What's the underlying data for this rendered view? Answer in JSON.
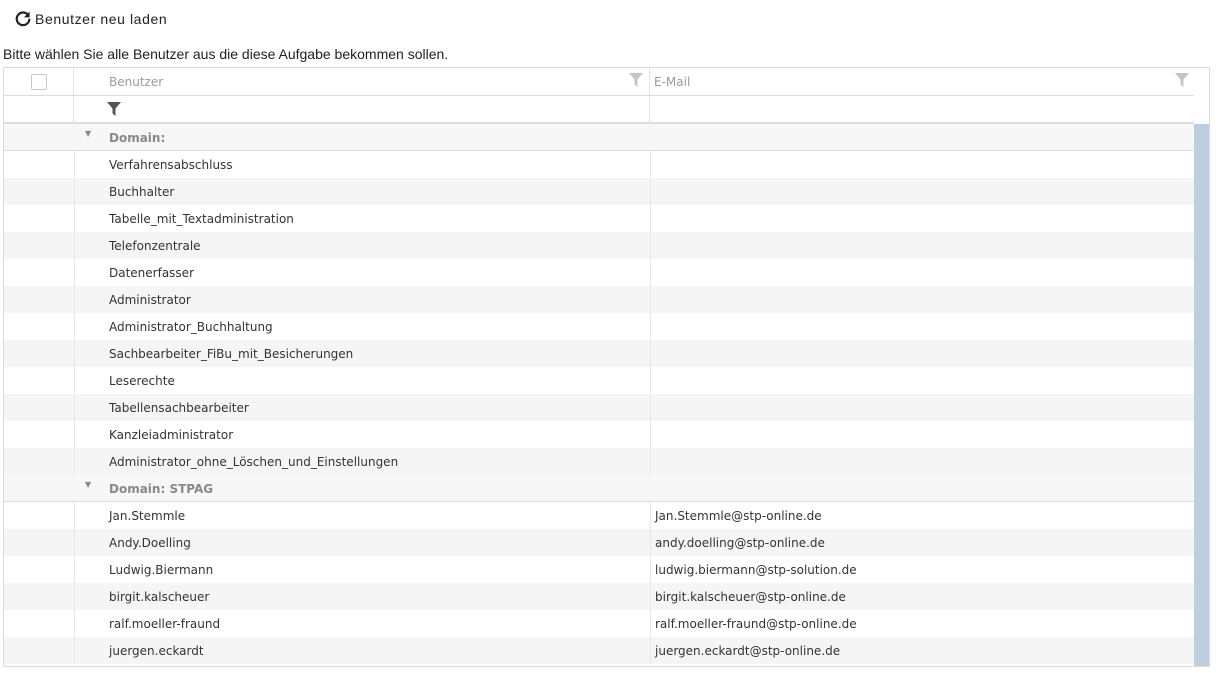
{
  "toolbar": {
    "reload_label": "Benutzer neu laden"
  },
  "instruction": "Bitte wählen Sie alle Benutzer aus die diese Aufgabe bekommen sollen.",
  "columns": {
    "user": "Benutzer",
    "email": "E-Mail"
  },
  "groups": [
    {
      "label": "Domain:",
      "rows": [
        {
          "user": "Verfahrensabschluss",
          "email": ""
        },
        {
          "user": "Buchhalter",
          "email": ""
        },
        {
          "user": "Tabelle_mit_Textadministration",
          "email": ""
        },
        {
          "user": "Telefonzentrale",
          "email": ""
        },
        {
          "user": "Datenerfasser",
          "email": ""
        },
        {
          "user": "Administrator",
          "email": ""
        },
        {
          "user": "Administrator_Buchhaltung",
          "email": ""
        },
        {
          "user": "Sachbearbeiter_FiBu_mit_Besicherungen",
          "email": ""
        },
        {
          "user": "Leserechte",
          "email": ""
        },
        {
          "user": "Tabellensachbearbeiter",
          "email": ""
        },
        {
          "user": "Kanzleiadministrator",
          "email": ""
        },
        {
          "user": "Administrator_ohne_Löschen_und_Einstellungen",
          "email": ""
        }
      ]
    },
    {
      "label": "Domain: STPAG",
      "rows": [
        {
          "user": "Jan.Stemmle",
          "email": "Jan.Stemmle@stp-online.de"
        },
        {
          "user": "Andy.Doelling",
          "email": "andy.doelling@stp-online.de"
        },
        {
          "user": "Ludwig.Biermann",
          "email": "ludwig.biermann@stp-solution.de"
        },
        {
          "user": "birgit.kalscheuer",
          "email": "birgit.kalscheuer@stp-online.de"
        },
        {
          "user": "ralf.moeller-fraund",
          "email": "ralf.moeller-fraund@stp-online.de"
        },
        {
          "user": "juergen.eckardt",
          "email": "juergen.eckardt@stp-online.de"
        }
      ]
    }
  ],
  "icons": {
    "reload": "reload-icon",
    "filter": "filter-icon",
    "expand": "caret-down-icon"
  },
  "colors": {
    "scroll_thumb": "#bfcde0",
    "alt_row": "#f5f5f5",
    "header_text": "#9a9a9a"
  }
}
